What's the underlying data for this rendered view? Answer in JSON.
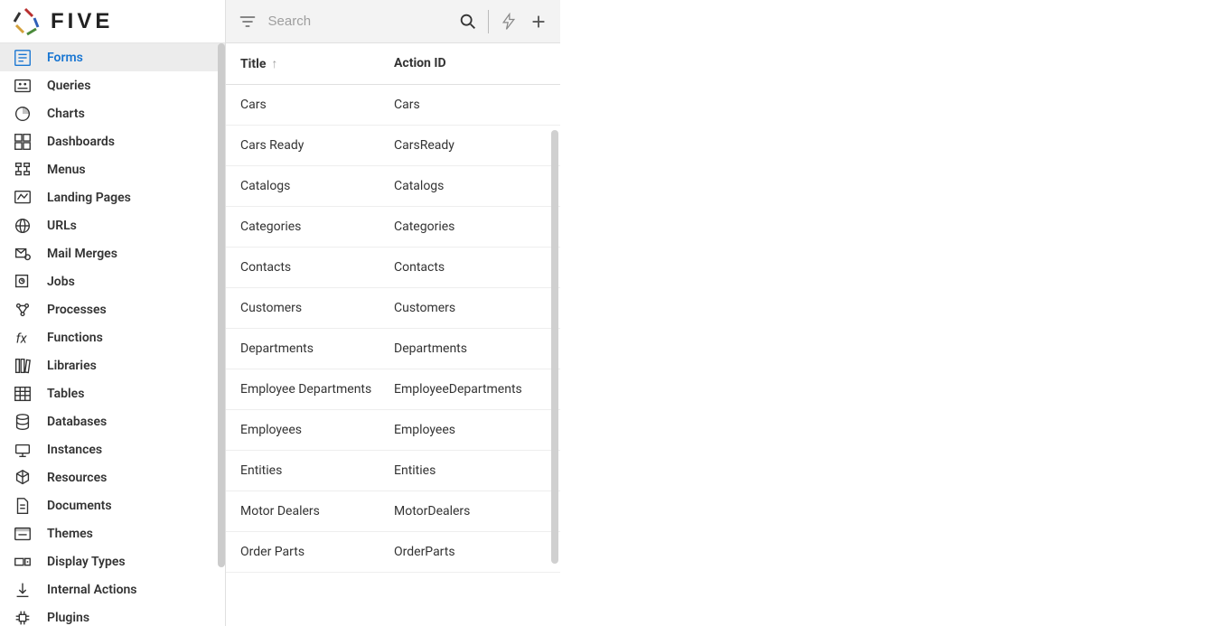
{
  "logo_text": "FIVE",
  "search": {
    "placeholder": "Search",
    "value": ""
  },
  "sidebar": {
    "items": [
      {
        "label": "Forms",
        "icon": "form"
      },
      {
        "label": "Queries",
        "icon": "query"
      },
      {
        "label": "Charts",
        "icon": "chart"
      },
      {
        "label": "Dashboards",
        "icon": "dashboard"
      },
      {
        "label": "Menus",
        "icon": "menu"
      },
      {
        "label": "Landing Pages",
        "icon": "landing"
      },
      {
        "label": "URLs",
        "icon": "url"
      },
      {
        "label": "Mail Merges",
        "icon": "mail"
      },
      {
        "label": "Jobs",
        "icon": "job"
      },
      {
        "label": "Processes",
        "icon": "process"
      },
      {
        "label": "Functions",
        "icon": "function"
      },
      {
        "label": "Libraries",
        "icon": "library"
      },
      {
        "label": "Tables",
        "icon": "table"
      },
      {
        "label": "Databases",
        "icon": "database"
      },
      {
        "label": "Instances",
        "icon": "instance"
      },
      {
        "label": "Resources",
        "icon": "resource"
      },
      {
        "label": "Documents",
        "icon": "document"
      },
      {
        "label": "Themes",
        "icon": "theme"
      },
      {
        "label": "Display Types",
        "icon": "display"
      },
      {
        "label": "Internal Actions",
        "icon": "internal"
      },
      {
        "label": "Plugins",
        "icon": "plugin"
      }
    ],
    "active_index": 0
  },
  "list": {
    "headers": {
      "title": "Title",
      "action_id": "Action ID"
    },
    "sort": {
      "column": "title",
      "direction": "asc"
    },
    "rows": [
      {
        "title": "Cars",
        "action_id": "Cars"
      },
      {
        "title": "Cars Ready",
        "action_id": "CarsReady"
      },
      {
        "title": "Catalogs",
        "action_id": "Catalogs"
      },
      {
        "title": "Categories",
        "action_id": "Categories"
      },
      {
        "title": "Contacts",
        "action_id": "Contacts"
      },
      {
        "title": "Customers",
        "action_id": "Customers"
      },
      {
        "title": "Departments",
        "action_id": "Departments"
      },
      {
        "title": "Employee Departments",
        "action_id": "EmployeeDepartments"
      },
      {
        "title": "Employees",
        "action_id": "Employees"
      },
      {
        "title": "Entities",
        "action_id": "Entities"
      },
      {
        "title": "Motor Dealers",
        "action_id": "MotorDealers"
      },
      {
        "title": "Order Parts",
        "action_id": "OrderParts"
      }
    ]
  }
}
